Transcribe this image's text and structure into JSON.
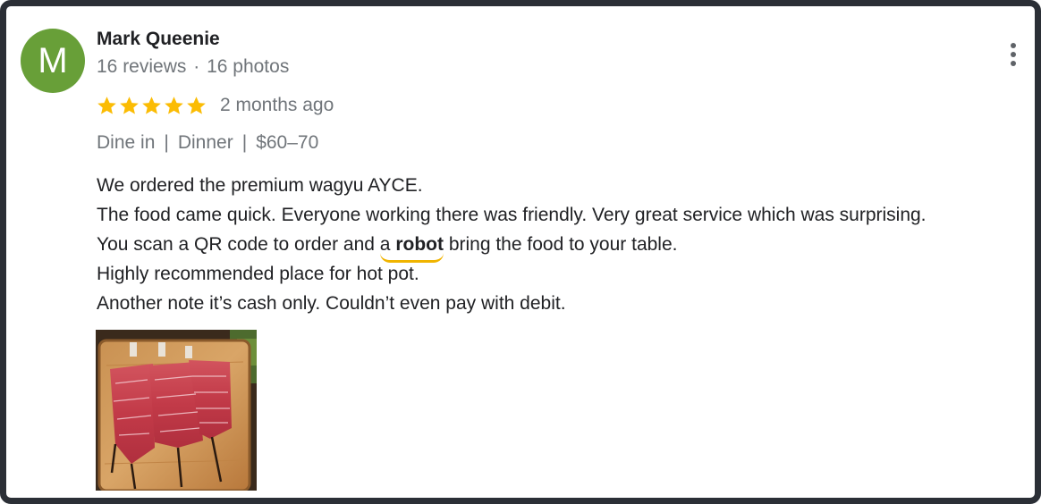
{
  "review": {
    "avatar_letter": "M",
    "author_name": "Mark Queenie",
    "reviews_count": "16 reviews",
    "meta_separator": "·",
    "photos_count": "16 photos",
    "rating": 5,
    "rating_max": 5,
    "date": "2 months ago",
    "details": {
      "service": "Dine in",
      "meal": "Dinner",
      "price": "$60–70",
      "separator": "|"
    },
    "text_lines": [
      "We ordered the premium wagyu AYCE.",
      "The food came quick. Everyone working there was friendly. Very great service which was surprising.",
      "You scan a QR code to order and",
      "Highly recommended place for hot pot.",
      "Another note it’s cash only. Couldn’t even pay with debit."
    ],
    "highlight": {
      "article": "a",
      "word": "robot",
      "after": "bring the food to your table."
    }
  },
  "icons": {
    "more": "more-vert-icon",
    "star": "star-icon"
  },
  "colors": {
    "avatar_bg": "#689f38",
    "star": "#fbbc04",
    "highlight_underline": "#f0b400",
    "frame_border": "#2b2f36"
  }
}
